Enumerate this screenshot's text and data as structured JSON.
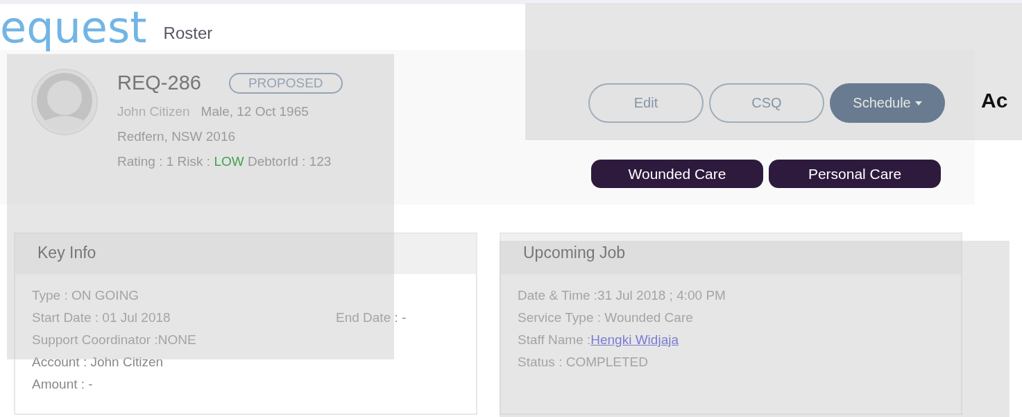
{
  "page_title": "equest",
  "back_link": "Roster",
  "request": {
    "id": "REQ-286",
    "status": "PROPOSED",
    "name": "John Citizen",
    "details": "Male, 12 Oct 1965",
    "address": "Redfern, NSW 2016",
    "meta": [
      {
        "label": "Rating : 1 Risk : ",
        "kind": "plain"
      },
      {
        "label": "LOW",
        "kind": "risk",
        "color": "#3fa34d"
      },
      {
        "label": " DebtorId : 123",
        "kind": "plain"
      }
    ]
  },
  "actions": [
    {
      "label": "Edit",
      "kind": "outline"
    },
    {
      "label": "CSQ",
      "kind": "outline"
    },
    {
      "label": "Schedule",
      "kind": "dropdown"
    }
  ],
  "tags": [
    "Wounded Care",
    "Personal Care"
  ],
  "side_heading": "Ac",
  "key_info": {
    "title": "Key Info",
    "rows": [
      {
        "left": "Type : ON GOING"
      },
      {
        "left": "Start Date : 01 Jul 2018",
        "right": "End Date : -"
      },
      {
        "left": "Support Coordinator :NONE"
      },
      {
        "left": "Account : John Citizen"
      },
      {
        "left": "Amount : -"
      }
    ]
  },
  "upcoming_job": {
    "title": "Upcoming Job",
    "rows": [
      {
        "label": "Date & Time :31 Jul 2018 ; 4:00 PM"
      },
      {
        "label": "Service Type : Wounded Care"
      },
      {
        "label": "Staff Name : ",
        "link": "Hengki Widjaja"
      },
      {
        "label": "Status : COMPLETED"
      }
    ]
  }
}
